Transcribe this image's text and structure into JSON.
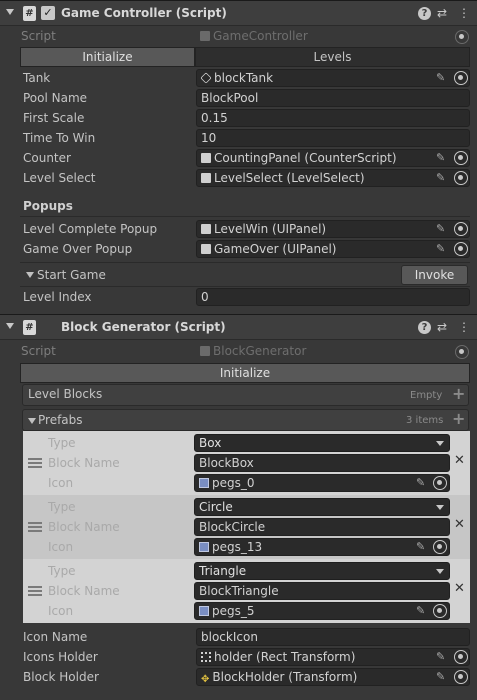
{
  "game_controller": {
    "title": "Game Controller (Script)",
    "script_label": "Script",
    "script_value": "GameController",
    "tabs": [
      "Initialize",
      "Levels"
    ],
    "fields": {
      "tank": {
        "label": "Tank",
        "value": "blockTank"
      },
      "pool_name": {
        "label": "Pool Name",
        "value": "BlockPool"
      },
      "first_scale": {
        "label": "First Scale",
        "value": "0.15"
      },
      "time_to_win": {
        "label": "Time To Win",
        "value": "10"
      },
      "counter": {
        "label": "Counter",
        "value": "CountingPanel (CounterScript)"
      },
      "level_select": {
        "label": "Level Select",
        "value": "LevelSelect (LevelSelect)"
      }
    },
    "popups_title": "Popups",
    "popups": {
      "level_complete": {
        "label": "Level Complete Popup",
        "value": "LevelWin (UIPanel)"
      },
      "game_over": {
        "label": "Game Over Popup",
        "value": "GameOver (UIPanel)"
      }
    },
    "start_game_label": "Start Game",
    "invoke_label": "Invoke",
    "level_index": {
      "label": "Level Index",
      "value": "0"
    }
  },
  "block_generator": {
    "title": "Block Generator (Script)",
    "script_label": "Script",
    "script_value": "BlockGenerator",
    "tab": "Initialize",
    "level_blocks": {
      "label": "Level Blocks",
      "count": "Empty"
    },
    "prefabs": {
      "label": "Prefabs",
      "count": "3 items"
    },
    "field_labels": {
      "type": "Type",
      "block_name": "Block Name",
      "icon": "Icon"
    },
    "items": [
      {
        "type": "Box",
        "block_name": "BlockBox",
        "icon": "pegs_0"
      },
      {
        "type": "Circle",
        "block_name": "BlockCircle",
        "icon": "pegs_13"
      },
      {
        "type": "Triangle",
        "block_name": "BlockTriangle",
        "icon": "pegs_5"
      }
    ],
    "icon_name": {
      "label": "Icon Name",
      "value": "blockIcon"
    },
    "icons_holder": {
      "label": "Icons Holder",
      "value": "holder (Rect Transform)"
    },
    "block_holder": {
      "label": "Block Holder",
      "value": "BlockHolder (Transform)"
    }
  },
  "header_icons": [
    "help-icon",
    "preset-icon",
    "kebab-menu-icon"
  ]
}
